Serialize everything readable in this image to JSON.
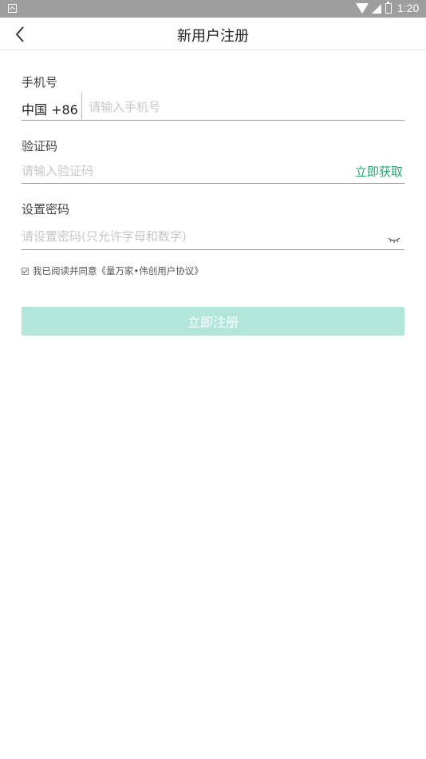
{
  "status_bar": {
    "time": "1:20",
    "icons": [
      "app-notification-icon",
      "wifi-icon",
      "signal-icon",
      "battery-icon"
    ]
  },
  "nav": {
    "back_icon": "chevron-left-icon",
    "title": "新用户注册"
  },
  "phone": {
    "label": "手机号",
    "country_code": "中国 +86",
    "placeholder": "请输入手机号",
    "value": ""
  },
  "code": {
    "label": "验证码",
    "placeholder": "请输入验证码",
    "value": "",
    "get_code_label": "立即获取"
  },
  "password": {
    "label": "设置密码",
    "placeholder": "请设置密码(只允许字母和数字)",
    "value": "",
    "toggle_icon": "eye-closed-icon"
  },
  "agreement": {
    "checked": true,
    "text": "我已阅读并同意《量万家•伟创用户协议》"
  },
  "submit": {
    "label": "立即注册"
  },
  "colors": {
    "accent_green": "#2aa773",
    "button_disabled": "#b2e6da",
    "status_bar": "#9e9e9e"
  }
}
